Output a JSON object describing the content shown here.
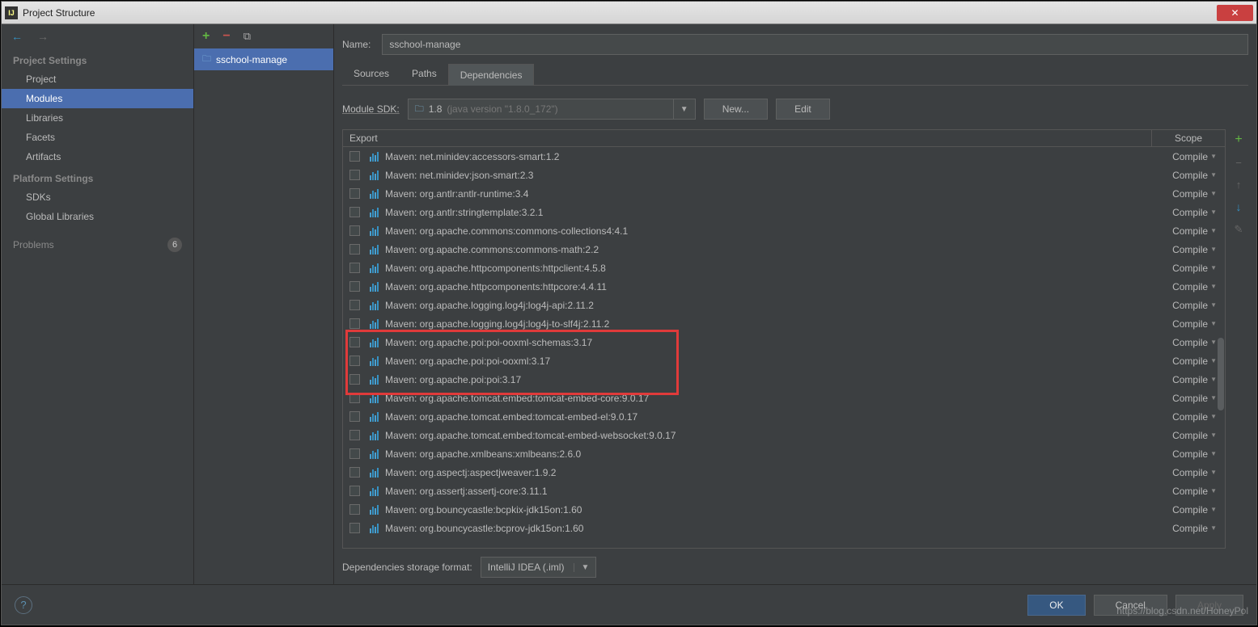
{
  "window": {
    "title": "Project Structure"
  },
  "nav": {
    "section1": "Project Settings",
    "items1": [
      "Project",
      "Modules",
      "Libraries",
      "Facets",
      "Artifacts"
    ],
    "section2": "Platform Settings",
    "items2": [
      "SDKs",
      "Global Libraries"
    ],
    "problems_label": "Problems",
    "problems_count": "6"
  },
  "module_tree": {
    "selected": "sschool-manage"
  },
  "main": {
    "name_label": "Name:",
    "name_value": "sschool-manage",
    "tabs": [
      "Sources",
      "Paths",
      "Dependencies"
    ],
    "active_tab": 2,
    "sdk_label": "Module SDK:",
    "sdk_value": "1.8",
    "sdk_hint": "(java version \"1.8.0_172\")",
    "new_btn": "New...",
    "edit_btn": "Edit",
    "export_header": "Export",
    "scope_header": "Scope",
    "storage_label": "Dependencies storage format:",
    "storage_value": "IntelliJ IDEA (.iml)"
  },
  "dependencies": [
    {
      "name": "Maven: net.minidev:accessors-smart:1.2",
      "scope": "Compile"
    },
    {
      "name": "Maven: net.minidev:json-smart:2.3",
      "scope": "Compile"
    },
    {
      "name": "Maven: org.antlr:antlr-runtime:3.4",
      "scope": "Compile"
    },
    {
      "name": "Maven: org.antlr:stringtemplate:3.2.1",
      "scope": "Compile"
    },
    {
      "name": "Maven: org.apache.commons:commons-collections4:4.1",
      "scope": "Compile"
    },
    {
      "name": "Maven: org.apache.commons:commons-math:2.2",
      "scope": "Compile"
    },
    {
      "name": "Maven: org.apache.httpcomponents:httpclient:4.5.8",
      "scope": "Compile"
    },
    {
      "name": "Maven: org.apache.httpcomponents:httpcore:4.4.11",
      "scope": "Compile"
    },
    {
      "name": "Maven: org.apache.logging.log4j:log4j-api:2.11.2",
      "scope": "Compile"
    },
    {
      "name": "Maven: org.apache.logging.log4j:log4j-to-slf4j:2.11.2",
      "scope": "Compile"
    },
    {
      "name": "Maven: org.apache.poi:poi-ooxml-schemas:3.17",
      "scope": "Compile"
    },
    {
      "name": "Maven: org.apache.poi:poi-ooxml:3.17",
      "scope": "Compile"
    },
    {
      "name": "Maven: org.apache.poi:poi:3.17",
      "scope": "Compile"
    },
    {
      "name": "Maven: org.apache.tomcat.embed:tomcat-embed-core:9.0.17",
      "scope": "Compile"
    },
    {
      "name": "Maven: org.apache.tomcat.embed:tomcat-embed-el:9.0.17",
      "scope": "Compile"
    },
    {
      "name": "Maven: org.apache.tomcat.embed:tomcat-embed-websocket:9.0.17",
      "scope": "Compile"
    },
    {
      "name": "Maven: org.apache.xmlbeans:xmlbeans:2.6.0",
      "scope": "Compile"
    },
    {
      "name": "Maven: org.aspectj:aspectjweaver:1.9.2",
      "scope": "Compile"
    },
    {
      "name": "Maven: org.assertj:assertj-core:3.11.1",
      "scope": "Compile"
    },
    {
      "name": "Maven: org.bouncycastle:bcpkix-jdk15on:1.60",
      "scope": "Compile"
    },
    {
      "name": "Maven: org.bouncycastle:bcprov-jdk15on:1.60",
      "scope": "Compile"
    }
  ],
  "highlight": {
    "start": 10,
    "end": 12
  },
  "footer": {
    "ok": "OK",
    "cancel": "Cancel",
    "apply": "Apply"
  },
  "watermark": "https://blog.csdn.net/HoneyPol"
}
